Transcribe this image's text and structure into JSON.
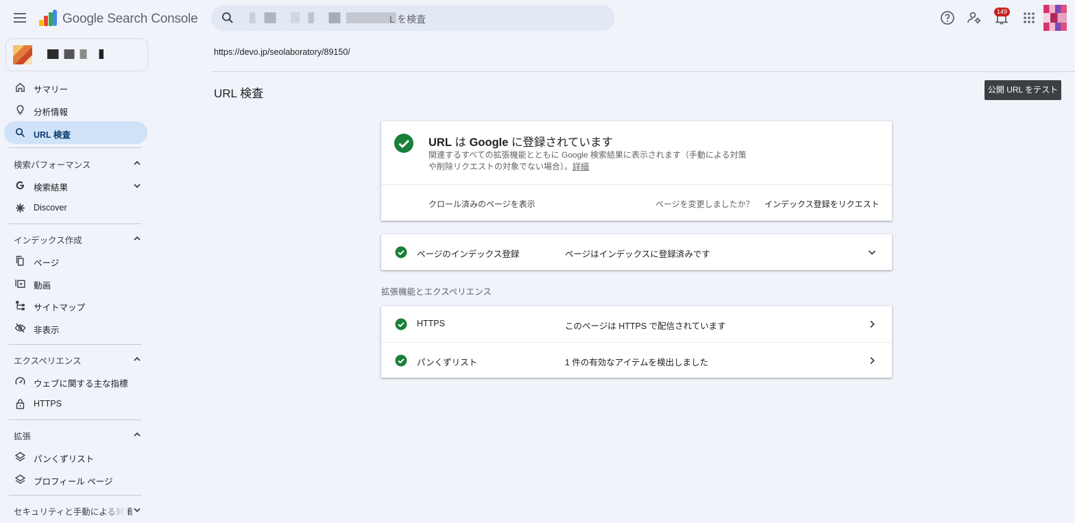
{
  "app": {
    "title": "Google Search Console"
  },
  "search": {
    "text_suffix": "L を検査"
  },
  "notifications": {
    "count": "149"
  },
  "sidebar": {
    "items_top": [
      {
        "label": "サマリー",
        "icon": "home-icon"
      },
      {
        "label": "分析情報",
        "icon": "lightbulb-icon"
      },
      {
        "label": "URL 検査",
        "icon": "search-icon",
        "active": true
      }
    ],
    "sections": [
      {
        "label": "検索パフォーマンス",
        "items": [
          {
            "label": "検索結果",
            "icon": "google-g-icon"
          },
          {
            "label": "Discover",
            "icon": "asterisk-icon"
          }
        ]
      },
      {
        "label": "インデックス作成",
        "items": [
          {
            "label": "ページ",
            "icon": "pages-icon"
          },
          {
            "label": "動画",
            "icon": "video-icon"
          },
          {
            "label": "サイトマップ",
            "icon": "sitemap-icon"
          },
          {
            "label": "非表示",
            "icon": "hidden-icon"
          }
        ]
      },
      {
        "label": "エクスペリエンス",
        "items": [
          {
            "label": "ウェブに関する主な指標",
            "icon": "gauge-icon"
          },
          {
            "label": "HTTPS",
            "icon": "lock-icon"
          }
        ]
      },
      {
        "label": "拡張",
        "items": [
          {
            "label": "パンくずリスト",
            "icon": "layers-icon"
          },
          {
            "label": "プロフィール ページ",
            "icon": "layers-icon"
          }
        ]
      },
      {
        "label": "セキュリティと手動による対策"
      }
    ]
  },
  "main": {
    "url": "https://devo.jp/seolaboratory/89150/",
    "title": "URL 検査",
    "test_button": "公開 URL をテスト",
    "status": {
      "title_prefix": "URL",
      "title_mid1": " は ",
      "title_google": "Google",
      "title_suffix": " に登録されています",
      "desc": "関連するすべての拡張機能とともに Google 検索結果に表示されます（手動による対策や削除リクエストの対象でない場合）。",
      "desc_link": "詳細",
      "crawl_link": "クロール済みのページを表示",
      "changed_q": "ページを変更しましたか？",
      "request_link": "インデックス登録をリクエスト"
    },
    "indexing": {
      "name": "ページのインデックス登録",
      "value": "ページはインデックスに登録済みです"
    },
    "enhancements_heading": "拡張機能とエクスペリエンス",
    "enhancements": [
      {
        "name": "HTTPS",
        "value": "このページは HTTPS で配信されています"
      },
      {
        "name": "パンくずリスト",
        "value": "1 件の有効なアイテムを検出しました"
      }
    ]
  },
  "colors": {
    "accent_green": "#188038",
    "active_nav": "#cfe2f8",
    "badge": "#c5221f"
  }
}
